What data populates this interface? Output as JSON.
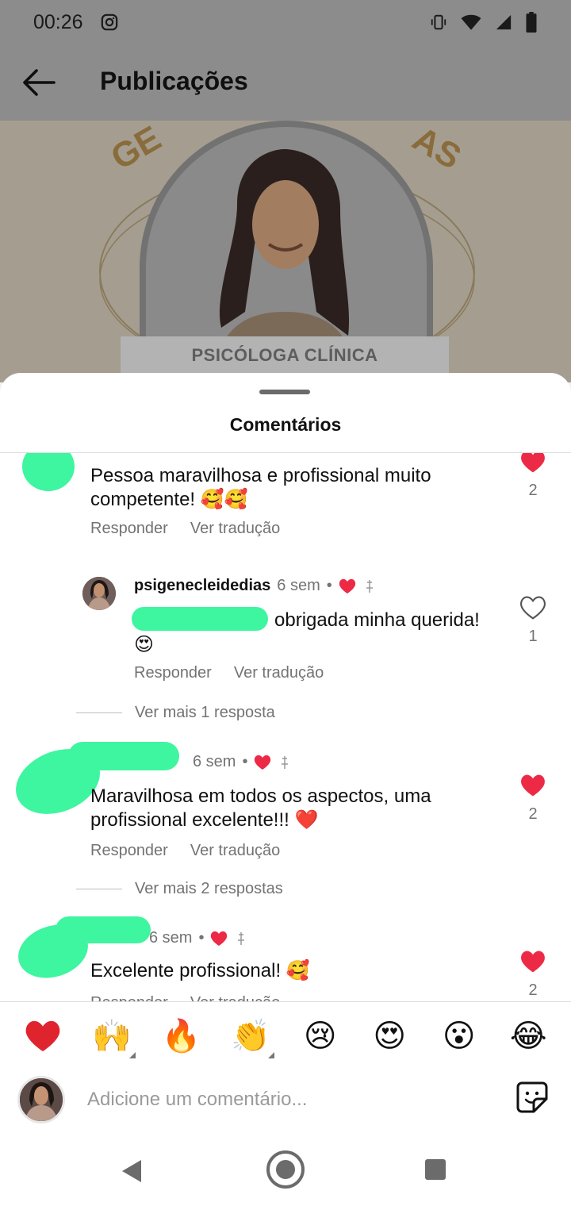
{
  "status_bar": {
    "time": "00:26"
  },
  "header": {
    "title": "Publicações"
  },
  "post": {
    "banner_text": "PSICÓLOGA CLÍNICA",
    "deco_left": "GE",
    "deco_right": "AS"
  },
  "sheet": {
    "title": "Comentários"
  },
  "comments": [
    {
      "text": "Pessoa maravilhosa e profissional muito competente! 🥰🥰",
      "reply_label": "Responder",
      "translate_label": "Ver tradução",
      "likes": "2",
      "liked": true
    },
    {
      "username": "psigenecleidedias",
      "time": "6 sem",
      "bullet": "•",
      "text": "obrigada minha querida!",
      "emoji": "😍",
      "reply_label": "Responder",
      "translate_label": "Ver tradução",
      "likes": "1",
      "liked": false
    },
    {
      "more_replies": "Ver mais 1 resposta"
    },
    {
      "time": "6 sem",
      "bullet": "•",
      "text": "Maravilhosa em todos os aspectos, uma profissional excelente!!! ❤️",
      "reply_label": "Responder",
      "translate_label": "Ver tradução",
      "likes": "2",
      "liked": true,
      "more_replies": "Ver mais 2 respostas"
    },
    {
      "time": "6 sem",
      "bullet": "•",
      "text": "Excelente profissional! 🥰",
      "reply_label": "Responder",
      "translate_label": "Ver tradução",
      "likes": "2",
      "liked": true
    }
  ],
  "reactions": [
    "❤️",
    "🙌",
    "🔥",
    "👏",
    "😢",
    "😍",
    "😮",
    "😂"
  ],
  "composer": {
    "placeholder": "Adicione um comentário..."
  },
  "colors": {
    "heart": "#ed2a45",
    "redaction": "#3ef5a0",
    "muted": "#737373",
    "overlay": "#8c8c8c"
  },
  "icons": {
    "back": "arrow-left-icon",
    "sticker": "sticker-icon",
    "heart": "heart-icon",
    "nav_back": "triangle-back-icon",
    "nav_home": "circle-home-icon",
    "nav_recents": "square-recents-icon"
  }
}
